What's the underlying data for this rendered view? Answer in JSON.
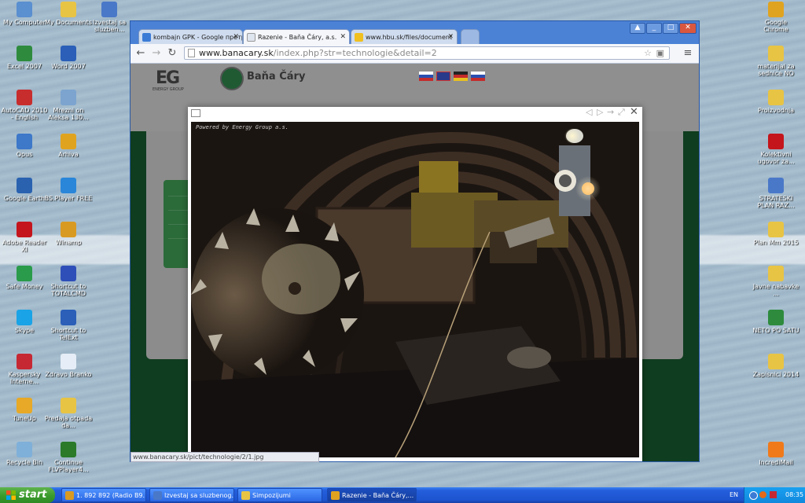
{
  "desktop": {
    "left_icons": [
      {
        "label": "My Computer",
        "icon": "computer-icon",
        "color": "#5a8fd0"
      },
      {
        "label": "My Documents",
        "icon": "folder-icon",
        "color": "#e8c445"
      },
      {
        "label": "Izvestaj sa sluzben...",
        "icon": "word-doc-icon",
        "color": "#4a78c8"
      },
      {
        "label": "Excel 2007",
        "icon": "excel-icon",
        "color": "#2e8b3e"
      },
      {
        "label": "Word 2007",
        "icon": "word-icon",
        "color": "#2b5fb8"
      },
      {
        "label": "AutoCAD 2010 - English",
        "icon": "autocad-icon",
        "color": "#c82d2d"
      },
      {
        "label": "Mrezni on Aleksa 130...",
        "icon": "network-icon",
        "color": "#7ca4cf"
      },
      {
        "label": "Opus",
        "icon": "opus-icon",
        "color": "#3d78c9"
      },
      {
        "label": "Arhiva",
        "icon": "chrome-icon",
        "color": "#e0a320"
      },
      {
        "label": "Google Earth",
        "icon": "google-earth-icon",
        "color": "#2a62b0"
      },
      {
        "label": "BS.Player FREE",
        "icon": "bsplayer-icon",
        "color": "#2a86d9"
      },
      {
        "label": "Adobe Reader XI",
        "icon": "adobe-reader-icon",
        "color": "#c4151c"
      },
      {
        "label": "Winamp",
        "icon": "winamp-icon",
        "color": "#d99a22"
      },
      {
        "label": "Safe Money",
        "icon": "safe-money-icon",
        "color": "#2a9b4a"
      },
      {
        "label": "Shortcut to TOTALCMD",
        "icon": "floppy-icon",
        "color": "#2e4fb8"
      },
      {
        "label": "Skype",
        "icon": "skype-icon",
        "color": "#1aa3e6"
      },
      {
        "label": "Shortcut to TelExt",
        "icon": "phone-icon",
        "color": "#2b5fb8"
      },
      {
        "label": "Kaspersky Interne...",
        "icon": "kaspersky-icon",
        "color": "#c62833"
      },
      {
        "label": "Zdravo Branko",
        "icon": "text-doc-icon",
        "color": "#e6edf6"
      },
      {
        "label": "TuneUp",
        "icon": "tuneup-icon",
        "color": "#e7a927"
      },
      {
        "label": "Predaja otpada da...",
        "icon": "folder-icon",
        "color": "#e8c445"
      },
      {
        "label": "Recycle Bin",
        "icon": "recycle-bin-icon",
        "color": "#7fb0d9"
      },
      {
        "label": "Continue FLVPlayer4...",
        "icon": "flvplayer-icon",
        "color": "#2a7a2a"
      }
    ],
    "right_icons": [
      {
        "label": "Google Chrome",
        "icon": "chrome-icon",
        "color": "#e0a320"
      },
      {
        "label": "materijal za sednice NO",
        "icon": "folder-icon",
        "color": "#e8c445"
      },
      {
        "label": "Proizvodnja",
        "icon": "folder-icon",
        "color": "#e8c445"
      },
      {
        "label": "Kolektivni ugovor za...",
        "icon": "pdf-icon",
        "color": "#c4151c"
      },
      {
        "label": "STRATESKI PLAN RAZ...",
        "icon": "word-doc-icon",
        "color": "#4a78c8"
      },
      {
        "label": "Plan Mm 2015",
        "icon": "folder-icon",
        "color": "#e8c445"
      },
      {
        "label": "Javne nabavke ...",
        "icon": "folder-icon",
        "color": "#e8c445"
      },
      {
        "label": "NETO PO SATU",
        "icon": "excel-doc-icon",
        "color": "#2e8b3e"
      },
      {
        "label": "Zapisnici 2014",
        "icon": "folder-icon",
        "color": "#e8c445"
      },
      {
        "label": "IncrediMail",
        "icon": "incredimail-icon",
        "color": "#f07a1a"
      }
    ]
  },
  "browser": {
    "tabs": [
      {
        "label": "kombajn GPK - Google претр",
        "icon": "google-icon",
        "color": "#3b7bd6"
      },
      {
        "label": "Razenie - Baňa Čáry, a.s.",
        "icon": "page-icon",
        "color": "#f4f6fa"
      },
      {
        "label": "www.hbu.sk/files/document",
        "icon": "mining-icon",
        "color": "#f0c020"
      }
    ],
    "url_host": "www.banacary.sk",
    "url_path": "/index.php?str=technologie&detail=2",
    "status_url": "www.banacary.sk/pict/technologie/2/1.jpg"
  },
  "site": {
    "logo_text": "EG",
    "logo_sub": "ENERGY GROUP",
    "brand": "Baňa Čáry"
  },
  "lightbox": {
    "photo_label": "Powered by Energy Group a.s."
  },
  "taskbar": {
    "start_label": "start",
    "buttons": [
      {
        "label": "1. 892 892 (Radio B9...",
        "icon": "winamp-icon",
        "color": "#d99a22"
      },
      {
        "label": "Izvestaj sa sluzbenog...",
        "icon": "word-doc-icon",
        "color": "#4a78c8"
      },
      {
        "label": "Simpozijumi",
        "icon": "folder-icon",
        "color": "#e8c445"
      },
      {
        "label": "Razenie - Baňa Čáry,...",
        "icon": "chrome-icon",
        "color": "#e0a320"
      }
    ],
    "lang": "EN",
    "clock": "08:35"
  }
}
